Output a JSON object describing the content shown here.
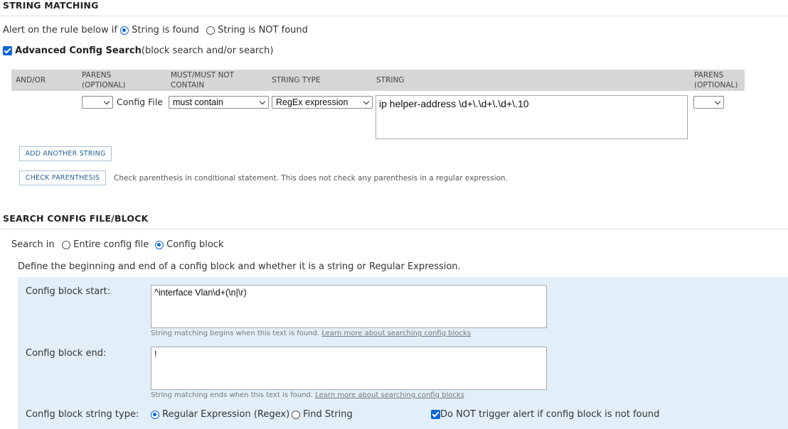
{
  "string_matching": {
    "title": "STRING MATCHING",
    "alert_label": "Alert on the rule below if",
    "opt_found": "String is found",
    "opt_not_found": "String is NOT found",
    "advanced_label": "Advanced Config Search",
    "advanced_suffix": "(block search and/or search)",
    "columns": {
      "and_or": "AND/OR",
      "parens_1": "PARENS",
      "parens_1b": "(OPTIONAL)",
      "must_1": "MUST/MUST NOT",
      "must_1b": "CONTAIN",
      "string_type": "STRING TYPE",
      "string": "STRING",
      "parens_2": "PARENS",
      "parens_2b": "(OPTIONAL)"
    },
    "row": {
      "open_paren": "",
      "source_label": "Config File",
      "must": "must contain",
      "string_type": "RegEx expression",
      "string_value": "ip helper-address \\d+\\.\\d+\\.\\d+\\.10",
      "close_paren": ""
    },
    "add_button": "ADD ANOTHER STRING",
    "check_button": "CHECK PARENTHESIS",
    "check_note": "Check parenthesis in conditional statement. This does not check any parenthesis in a regular expression."
  },
  "search_config": {
    "title": "SEARCH CONFIG FILE/BLOCK",
    "search_in_label": "Search in",
    "opt_entire": "Entire config file",
    "opt_block": "Config block",
    "define_text": "Define the beginning and end of a config block and whether it is a string or Regular Expression.",
    "start_label": "Config block start:",
    "start_value": "^interface Vlan\\d+(\\n|\\r)",
    "start_hint": "String matching begins when this text is found.",
    "start_link": "Learn more about searching config blocks",
    "end_label": "Config block end:",
    "end_value": "!",
    "end_hint": "String matching ends when this text is found.",
    "end_link": "Learn more about searching config blocks",
    "type_label": "Config block string type:",
    "opt_regex": "Regular Expression (Regex)",
    "opt_find": "Find String",
    "no_trigger_label": "Do NOT trigger alert if config block is not found"
  },
  "colors": {
    "accent": "#0a66d8",
    "panel": "#e2eff8",
    "header": "#d6d6d6"
  }
}
